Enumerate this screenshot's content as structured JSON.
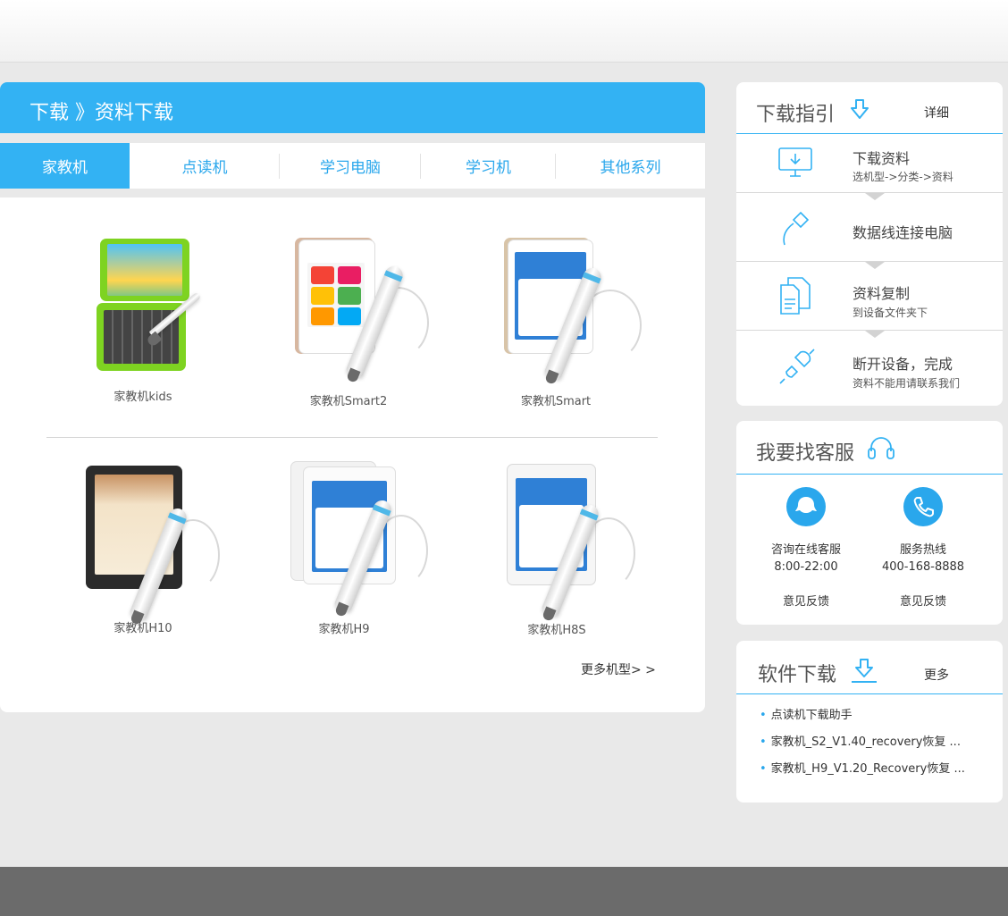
{
  "breadcrumb": "下载 》资料下载",
  "tabs": [
    {
      "label": "家教机",
      "active": true
    },
    {
      "label": "点读机",
      "active": false
    },
    {
      "label": "学习电脑",
      "active": false
    },
    {
      "label": "学习机",
      "active": false
    },
    {
      "label": "其他系列",
      "active": false
    }
  ],
  "products": [
    {
      "name": "家教机kids",
      "icon": "kids-tablet-with-keyboard-image"
    },
    {
      "name": "家教机Smart2",
      "icon": "gold-tablet-with-pen-image"
    },
    {
      "name": "家教机Smart",
      "icon": "gold-tablet-with-pen-image"
    },
    {
      "name": "家教机H10",
      "icon": "black-tablet-with-pen-image"
    },
    {
      "name": "家教机H9",
      "icon": "white-tablet-with-pen-image"
    },
    {
      "name": "家教机H8S",
      "icon": "white-tablet-with-pen-image"
    }
  ],
  "more_models": "更多机型> >",
  "guide": {
    "title": "下载指引",
    "link": "详细",
    "steps": [
      {
        "title": "下载资料",
        "sub": "选机型->分类->资料",
        "icon": "monitor-download-icon"
      },
      {
        "title": "数据线连接电脑",
        "sub": "",
        "icon": "usb-cable-icon"
      },
      {
        "title": "资料复制",
        "sub": "到设备文件夹下",
        "icon": "document-copy-icon"
      },
      {
        "title": "断开设备，完成",
        "sub": "资料不能用请联系我们",
        "icon": "unplug-icon"
      }
    ]
  },
  "service": {
    "title": "我要找客服",
    "online": {
      "label": "咨询在线客服",
      "hours": "8:00-22:00",
      "feedback": "意见反馈"
    },
    "hotline": {
      "label": "服务热线",
      "number": "400-168-8888",
      "feedback": "意见反馈"
    }
  },
  "software": {
    "title": "软件下载",
    "link": "更多",
    "items": [
      "点读机下载助手",
      "家教机_S2_V1.40_recovery恢复 ...",
      "家教机_H9_V1.20_Recovery恢复 ..."
    ]
  },
  "colors": {
    "accent": "#33b2f3",
    "link": "#2aa7ec",
    "footer": "#6b6b6b"
  }
}
